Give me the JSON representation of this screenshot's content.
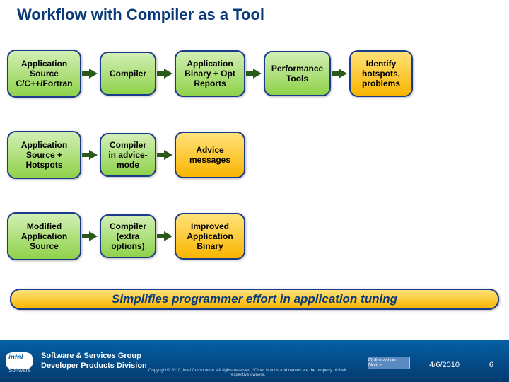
{
  "title": "Workflow with Compiler as a Tool",
  "rows": [
    {
      "b1": "Application Source C/C++/Fortran",
      "b2": "Compiler",
      "b3": "Application Binary + Opt Reports",
      "b4": "Performance Tools",
      "b5": "Identify hotspots, problems"
    },
    {
      "b1": "Application Source + Hotspots",
      "b2": "Compiler in advice-mode",
      "b3": "Advice messages"
    },
    {
      "b1": "Modified Application Source",
      "b2": "Compiler (extra options)",
      "b3": "Improved Application Binary"
    }
  ],
  "banner": "Simplifies programmer effort in application tuning",
  "footer": {
    "software": "Software",
    "group1": "Software & Services Group",
    "group2": "Developer Products Division",
    "copyright": "Copyright© 2010, Intel Corporation. All rights reserved. *Other brands and names are the property of their respective owners.",
    "badge": "Optimization Notice",
    "date": "4/6/2010",
    "page": "6"
  }
}
